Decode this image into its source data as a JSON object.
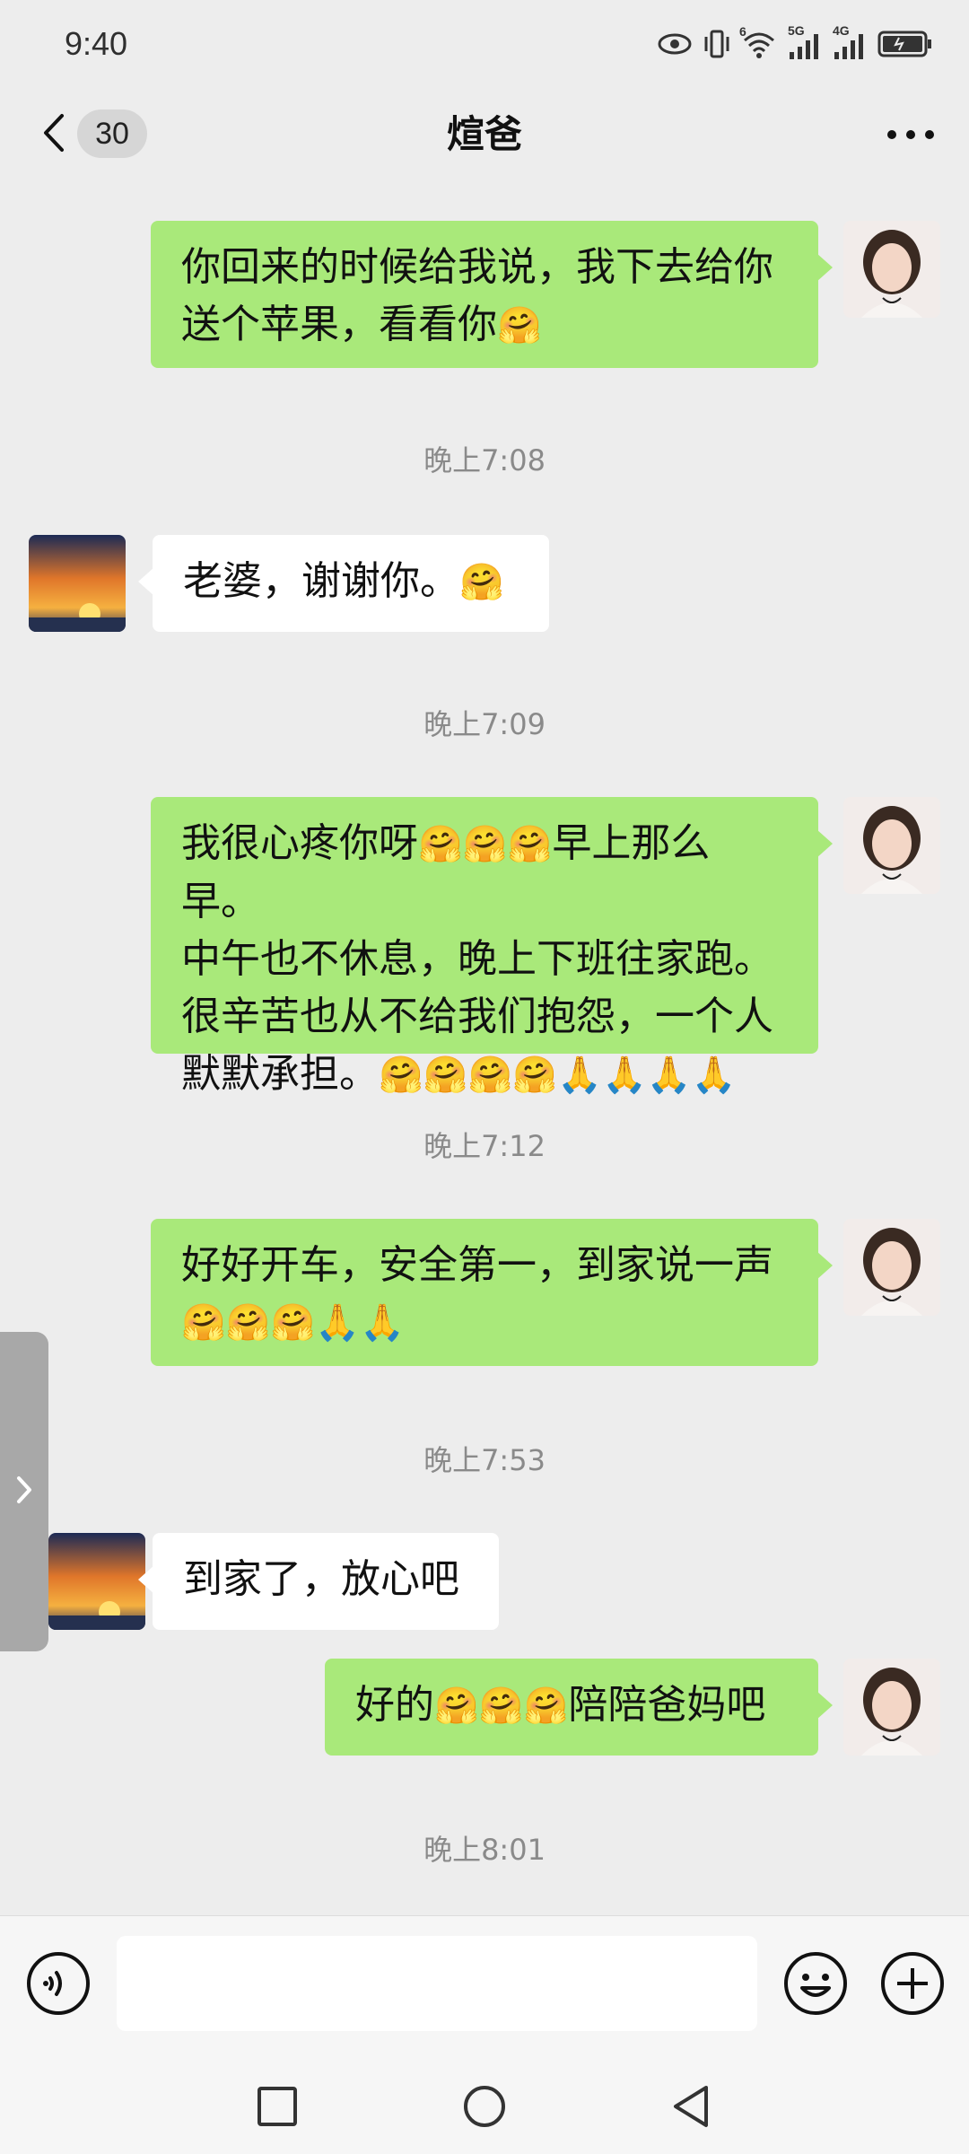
{
  "status_bar": {
    "time": "9:40",
    "signal_label_1": "5G",
    "signal_label_2": "4G",
    "wifi_label": "6"
  },
  "nav": {
    "unread_count": "30",
    "title": "煊爸"
  },
  "messages": [
    {
      "side": "me",
      "text": "你回来的时候给我说，我下去给你送个苹果，看看你",
      "emoji": "🤗"
    },
    {
      "side": "them",
      "text": "老婆，谢谢你。",
      "emoji": "🤗"
    },
    {
      "side": "me",
      "line1": "我很心疼你呀",
      "line1_emoji": "🤗🤗🤗",
      "line1_tail": "早上那么早。",
      "line2": "中午也不休息，晚上下班往家跑。",
      "line3": "很辛苦也从不给我们抱怨，一个人",
      "line4": "默默承担。",
      "line4_emoji": "🤗🤗🤗🤗🙏🙏🙏🙏"
    },
    {
      "side": "me",
      "line1": "好好开车，安全第一，到家说一声",
      "line2_emoji": "🤗🤗🤗🙏🙏"
    },
    {
      "side": "them",
      "text": "到家了，放心吧"
    },
    {
      "side": "me",
      "text_a": "好的",
      "emoji": "🤗🤗🤗",
      "text_b": "陪陪爸妈吧"
    }
  ],
  "timestamps": [
    "晚上7:08",
    "晚上7:09",
    "晚上7:12",
    "晚上7:53",
    "晚上8:01"
  ],
  "colors": {
    "background": "#ededed",
    "my_bubble": "#a9e97a",
    "their_bubble": "#ffffff",
    "timestamp": "#8a8a8a"
  },
  "icons": {
    "back": "chevron-left-icon",
    "more": "more-dots-icon",
    "voice": "voice-icon",
    "emoji": "emoji-icon",
    "plus": "plus-icon",
    "side_handle": "chevron-right-icon",
    "sys_recent": "square-icon",
    "sys_home": "circle-icon",
    "sys_back": "triangle-back-icon"
  }
}
